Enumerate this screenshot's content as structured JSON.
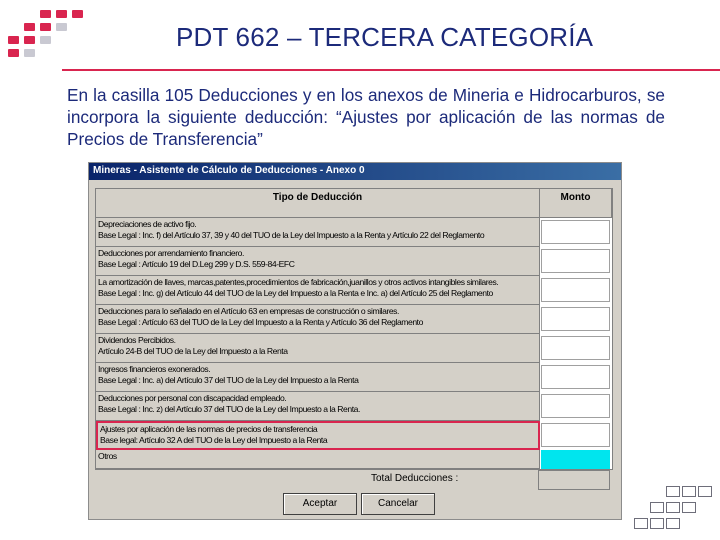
{
  "slide": {
    "title": "PDT 662 – TERCERA CATEGORÍA",
    "body_text": "En la casilla 105 Deducciones y en los anexos de Mineria e Hidrocarburos, se incorpora la siguiente deducción: “Ajustes por aplicación de las normas de Precios de Transferencia”"
  },
  "dialog": {
    "title": "Mineras - Asistente de Cálculo de Deducciones - Anexo 0",
    "columns": {
      "tipo": "Tipo de Deducción",
      "monto": "Monto"
    },
    "rows": [
      {
        "line1": "Depreciaciones de activo fijo.",
        "line2": "Base Legal : Inc. f) del Artículo 37, 39 y 40 del TUO de la Ley del Impuesto a la Renta y Artículo 22 del Reglamento",
        "monto": ""
      },
      {
        "line1": "Deducciones por arrendamiento financiero.",
        "line2": "Base Legal : Artículo 19 del D.Leg 299 y D.S. 559-84-EFC",
        "monto": ""
      },
      {
        "line1": "La amortización de llaves, marcas,patentes,procedimientos de fabricación,juanillos y otros activos intangibles similares.",
        "line2": "Base Legal : Inc. g) del Artículo 44 del TUO de la Ley del Impuesto a la Renta e Inc. a) del Artículo 25 del Reglamento",
        "monto": ""
      },
      {
        "line1": "Deducciones  para lo señalado en el Artículo 63 en empresas de construcción o similares.",
        "line2": "Base Legal : Artículo 63 del TUO de la Ley del Impuesto a la Renta y Artículo 36 del Reglamento",
        "monto": ""
      },
      {
        "line1": "Dividendos Percibidos.",
        "line2": "Artículo 24-B del TUO de la Ley del Impuesto a la Renta",
        "monto": ""
      },
      {
        "line1": "Ingresos financieros exonerados.",
        "line2": "Base Legal : Inc. a) del Artículo 37 del TUO de la Ley del Impuesto a la Renta",
        "monto": ""
      },
      {
        "line1": "Deducciones por personal con discapacidad empleado.",
        "line2": "Base Legal : Inc. z) del Artículo 37 del TUO de la Ley del Impuesto a la Renta.",
        "monto": ""
      },
      {
        "line1": "Ajustes por aplicación de las normas de precios de transferencia",
        "line2": "Base legal: Artículo 32 A del TUO de la Ley del Impuesto a la Renta",
        "monto": ""
      },
      {
        "line1": "Otros",
        "line2": "",
        "monto": ""
      }
    ],
    "total_label": "Total Deducciones :",
    "total_value": "",
    "accept_label": "Aceptar",
    "cancel_label": "Cancelar"
  },
  "colors": {
    "title_blue": "#1c2a7a",
    "accent_red": "#d9254f",
    "active_cyan": "#00e5ee",
    "dialog_grey": "#d4d0c8"
  }
}
